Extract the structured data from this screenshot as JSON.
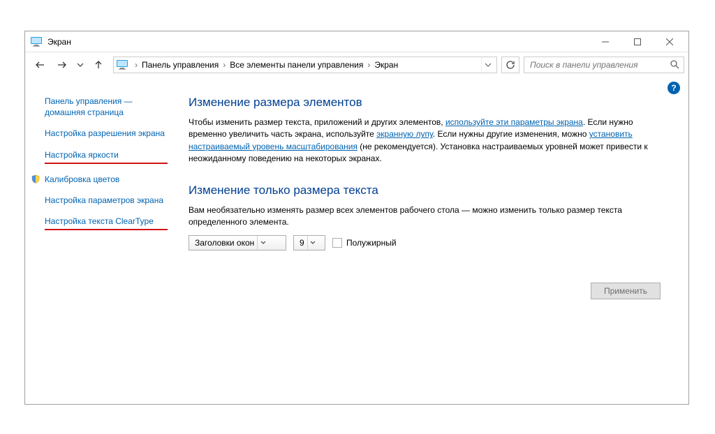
{
  "window": {
    "title": "Экран",
    "minimize": "—",
    "maximize": "□",
    "close": "×"
  },
  "breadcrumbs": {
    "items": [
      "Панель управления",
      "Все элементы панели управления",
      "Экран"
    ]
  },
  "search": {
    "placeholder": "Поиск в панели управления"
  },
  "help_badge": "?",
  "sidebar": {
    "items": [
      {
        "label": "Панель управления — домашняя страница",
        "underline": false,
        "shield": false
      },
      {
        "label": "Настройка разрешения экрана",
        "underline": false,
        "shield": false
      },
      {
        "label": "Настройка яркости",
        "underline": true,
        "shield": false
      },
      {
        "label": "Калибровка цветов",
        "underline": false,
        "shield": true
      },
      {
        "label": "Настройка параметров экрана",
        "underline": false,
        "shield": false
      },
      {
        "label": "Настройка текста ClearType",
        "underline": true,
        "shield": false
      }
    ]
  },
  "main": {
    "heading1": "Изменение размера элементов",
    "para1_pre": "Чтобы изменить размер текста, приложений и других элементов, ",
    "para1_link1": "используйте эти параметры экрана",
    "para1_mid1": ". Если нужно временно увеличить часть экрана, используйте ",
    "para1_link2": "экранную лупу",
    "para1_mid2": ". Если нужны другие изменения, можно ",
    "para1_link3": "установить настраиваемый уровень масштабирования",
    "para1_post": " (не рекомендуется). Установка настраиваемых уровней может привести к неожиданному поведению на некоторых экранах.",
    "heading2": "Изменение только размера текста",
    "para2": "Вам необязательно изменять размер всех элементов рабочего стола — можно изменить только размер текста определенного элемента.",
    "combo_element": "Заголовки окон",
    "combo_size": "9",
    "bold_label": "Полужирный",
    "apply": "Применить"
  }
}
